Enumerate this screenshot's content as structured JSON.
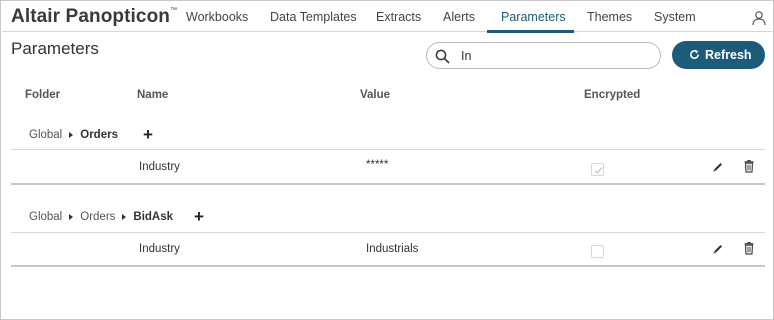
{
  "app": {
    "brand": "Altair Panopticon",
    "trademark": "™"
  },
  "nav": {
    "items": [
      {
        "label": "Workbooks"
      },
      {
        "label": "Data Templates"
      },
      {
        "label": "Extracts"
      },
      {
        "label": "Alerts"
      },
      {
        "label": "Parameters",
        "active": true
      },
      {
        "label": "Themes"
      },
      {
        "label": "System"
      }
    ],
    "user_icon": "user-icon"
  },
  "page": {
    "title": "Parameters"
  },
  "search": {
    "value": "In",
    "icon": "search-icon"
  },
  "refresh": {
    "label": "Refresh",
    "icon": "refresh-icon"
  },
  "columns": {
    "folder": "Folder",
    "name": "Name",
    "value": "Value",
    "encrypted": "Encrypted"
  },
  "groups": [
    {
      "path": [
        "Global",
        "Orders"
      ],
      "add_label": "+",
      "rows": [
        {
          "name": "Industry",
          "value": "*****",
          "encrypted": true
        }
      ]
    },
    {
      "path": [
        "Global",
        "Orders",
        "BidAsk"
      ],
      "add_label": "+",
      "rows": [
        {
          "name": "Industry",
          "value": "Industrials",
          "encrypted": false
        }
      ]
    }
  ],
  "colors": {
    "accent": "#1d5b7a",
    "text": "#333333",
    "divider": "#d8d8d8"
  }
}
